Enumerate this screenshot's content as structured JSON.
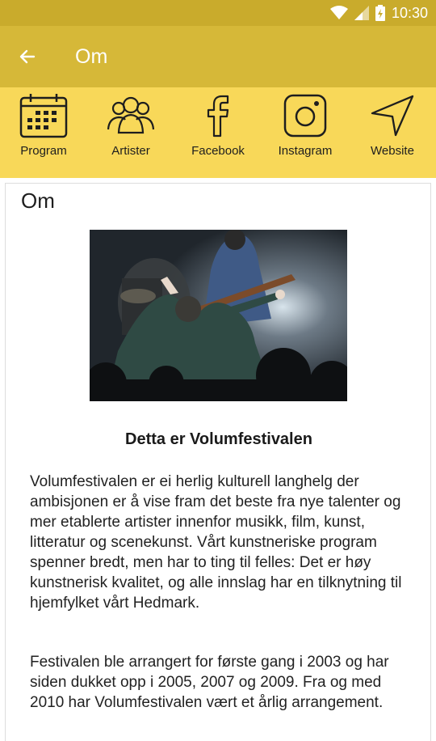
{
  "status_bar": {
    "time": "10:30"
  },
  "app_bar": {
    "title": "Om"
  },
  "nav": [
    {
      "label": "Program",
      "icon": "calendar-icon"
    },
    {
      "label": "Artister",
      "icon": "people-icon"
    },
    {
      "label": "Facebook",
      "icon": "facebook-icon"
    },
    {
      "label": "Instagram",
      "icon": "instagram-icon"
    },
    {
      "label": "Website",
      "icon": "navigation-arrow-icon"
    }
  ],
  "content": {
    "title": "Om",
    "heading": "Detta er Volumfestivalen",
    "paragraphs": [
      "Volumfestivalen er ei herlig kulturell langhelg der ambisjonen er å vise fram det beste fra nye talenter og mer etablerte artister innenfor musikk, film, kunst, litteratur og scenekunst. Vårt kunstneriske program spenner bredt, men har to ting til felles: Det er høy kunstnerisk kvalitet, og alle innslag har en tilknytning til hjemfylket vårt Hedmark.",
      "Festivalen ble arrangert for første gang i 2003 og har siden dukket opp i 2005, 2007 og 2009. Fra og med 2010 har Volumfestivalen vært et årlig arrangement."
    ]
  }
}
